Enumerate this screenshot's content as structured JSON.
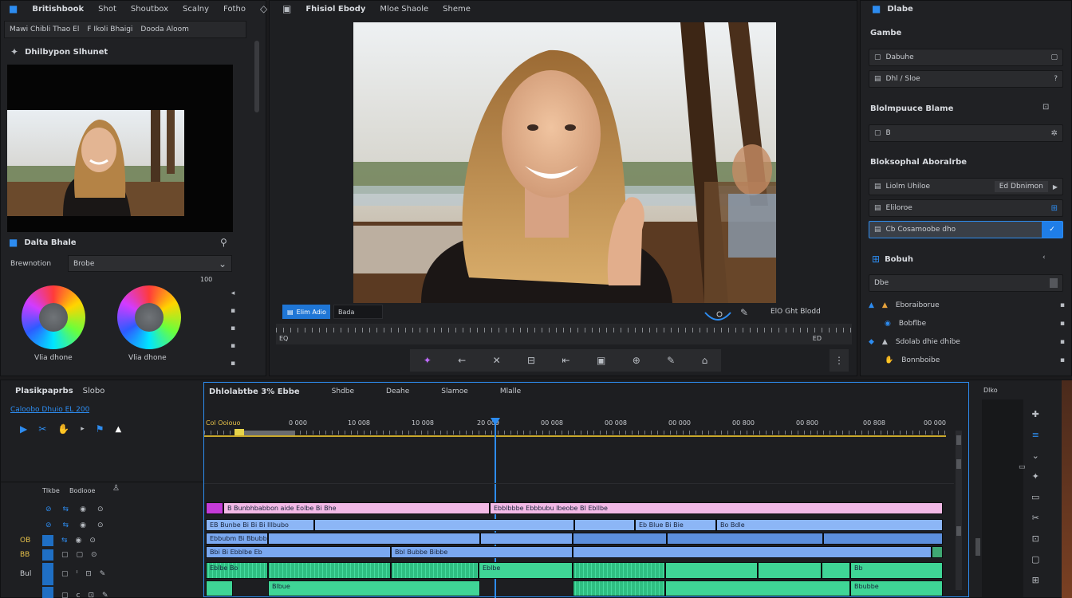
{
  "left_panel": {
    "menu": [
      "Britishbook",
      "Shot",
      "Shoutbox",
      "Scalny",
      "Fotho"
    ],
    "breadcrumb": [
      "Mawi Chibli Thao El",
      "F Ikoli Bhaigi",
      "Dooda Aloom"
    ],
    "media_title": "Dhilbypon Slhunet",
    "color_section_title": "Dalta Bhale",
    "dropdown_label": "Brewnotion",
    "dropdown_value": "Brobe",
    "scale_value": "100",
    "wheel1_label": "Vlia dhone",
    "wheel2_label": "Vlia dhone"
  },
  "viewer": {
    "tabs": [
      "Fhisiol Ebody",
      "Mloe Shaole",
      "Sheme"
    ],
    "active_chip": "Elim Adio",
    "chip2": "Bada",
    "timecode_readout": "ElO Ght Blodd",
    "ruler_start": "EQ",
    "ruler_end": "ED"
  },
  "inspector": {
    "title": "Dlabe",
    "sub_title": "Gambe",
    "field1": "Dabuhe",
    "field2": "Dhl / Sloe",
    "section2_title": "Blolmpuuce Blame",
    "field3": "B",
    "section3_title": "Bloksophal Aboralrbe",
    "field4_label": "Liolm Uhiloe",
    "field4_value": "Ed Dbnimon",
    "field5": "Eliloroe",
    "field6": "Cb Cosamoobe dho",
    "section4_title": "Bobuh",
    "sub4": "Dbe",
    "list": [
      "Eboraiborue",
      "Bobflbe",
      "Sdolab dhie dhibe",
      "Bonnboibe"
    ]
  },
  "timeline": {
    "left_title": "Plasikpaprbs",
    "left_tab": "Slobo",
    "left_sub": "Caloobo Dhuio EL 200",
    "track_hdr1": "Tlkbe",
    "track_hdr2": "Bodiooe",
    "tabs": [
      "Dhlolabtbe 3% Ebbe",
      "Shdbe",
      "Deahe",
      "Slamoe",
      "Mlalle"
    ],
    "ruler_labels": [
      "Col Ooiouo",
      "0 000",
      "10 008",
      "10 008",
      "20 009",
      "00 008",
      "00 008",
      "00 000",
      "00 800",
      "00 800",
      "00 808",
      "00 000"
    ],
    "right_label": "Dlko",
    "track_names": [
      "OB",
      "BB",
      "Bul"
    ],
    "clip_title_pink1": "B Bunbhbabbon aide Eolbe Bi Bhe",
    "clip_title_pink2": "Ebblbbbe Ebbbubu Ibeobe BI Ebllbe",
    "clip_v1a": "EB Bunbe Bi Bi Bi Illbubo",
    "clip_v1b": "Eb Blue Bi Bie",
    "clip_v1c": "Bo Bdle",
    "clip_v2a": "Ebbubm Bi Bbubbo",
    "clip_v3a": "Bbi Bi Ebblbe Eb",
    "clip_v3b": "Bbl Bubbe Bibbe",
    "clip_a1a": "Eblbe Bo",
    "clip_a1b": "Eblbe",
    "clip_a1c": "Bb",
    "clip_a2a": "Blbue",
    "clip_a2b": "Bbubbe"
  },
  "colors": {
    "accent": "#2d8cf0",
    "playhead": "#2d8cf0",
    "pink_clip": "#f2b9e6",
    "video_clip": "#7fb0f4",
    "audio_clip": "#3fd596"
  }
}
